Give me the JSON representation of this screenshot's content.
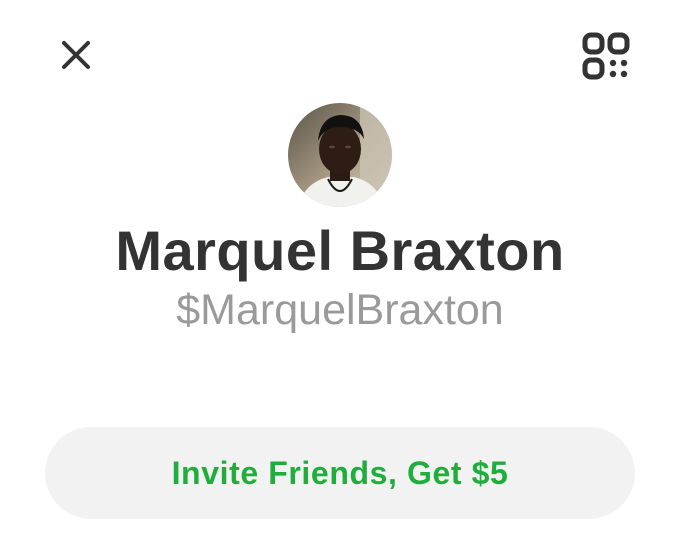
{
  "header": {
    "close_icon": "close-icon",
    "qr_icon": "qr-code-icon"
  },
  "profile": {
    "avatar": "profile-photo",
    "name": "Marquel Braxton",
    "cashtag": "$MarquelBraxton"
  },
  "actions": {
    "invite_label": "Invite Friends, Get $5",
    "invite_color": "#1fae3c",
    "invite_bg": "#f2f2f2"
  }
}
